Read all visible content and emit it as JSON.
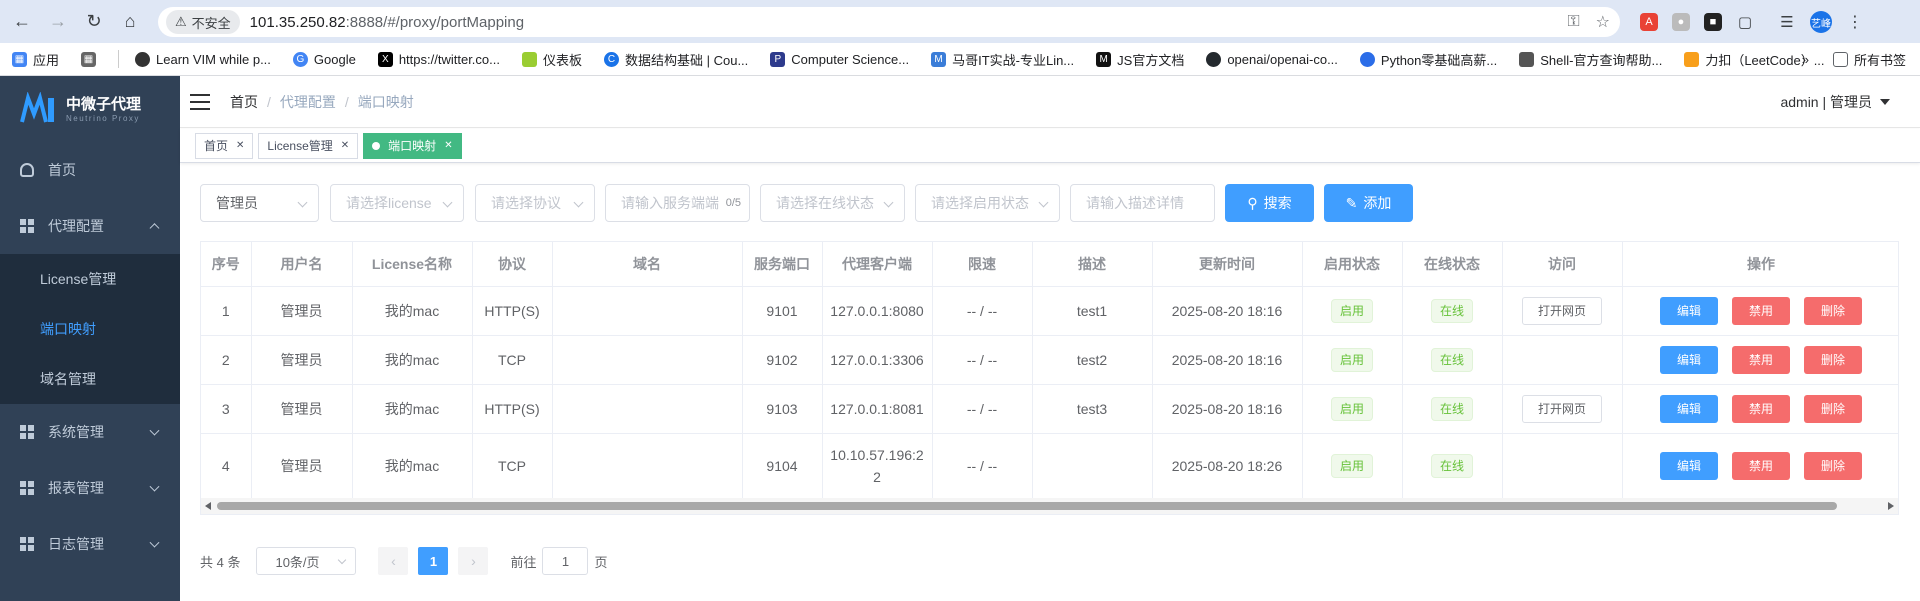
{
  "browser": {
    "insecure_label": "不安全",
    "url_host": "101.35.250.82",
    "url_rest": ":8888/#/proxy/portMapping",
    "profile_label": "艺峰"
  },
  "bookmarks": {
    "apps": "应用",
    "items": [
      "Learn VIM while p...",
      "Google",
      "https://twitter.co...",
      "仪表板",
      "数据结构基础 | Cou...",
      "Computer Science...",
      "马哥IT实战-专业Lin...",
      "JS官方文档",
      "openai/openai-co...",
      "Python零基础高薪...",
      "Shell-官方查询帮助...",
      "力扣（LeetCode）..."
    ],
    "more": "»",
    "all": "所有书签"
  },
  "sidebar": {
    "logo_title": "中微子代理",
    "logo_sub": "Neutrino Proxy",
    "home": "首页",
    "proxy_config": "代理配置",
    "sub": [
      "License管理",
      "端口映射",
      "域名管理"
    ],
    "system": "系统管理",
    "report": "报表管理",
    "log": "日志管理"
  },
  "header": {
    "crumbs": [
      "首页",
      "代理配置",
      "端口映射"
    ],
    "user": "admin | 管理员"
  },
  "tags": [
    "首页",
    "License管理",
    "端口映射"
  ],
  "filters": {
    "user": "管理员",
    "license": "请选择license",
    "protocol": "请选择协议",
    "port": "请输入服务端端",
    "port_count": "0/5",
    "online": "请选择在线状态",
    "enable": "请选择启用状态",
    "desc": "请输入描述详情",
    "search": "搜索",
    "add": "添加"
  },
  "table": {
    "headers": [
      "序号",
      "用户名",
      "License名称",
      "协议",
      "域名",
      "服务端口",
      "代理客户端",
      "限速",
      "描述",
      "更新时间",
      "启用状态",
      "在线状态",
      "访问",
      "操作"
    ],
    "rows": [
      {
        "no": "1",
        "user": "管理员",
        "license": "我的mac",
        "proto": "HTTP(S)",
        "domain": "",
        "port": "9101",
        "client": "127.0.0.1:8080",
        "limit": "-- / --",
        "desc": "test1",
        "time": "2025-08-20 18:16",
        "enable": "启用",
        "online": "在线",
        "visit": "打开网页"
      },
      {
        "no": "2",
        "user": "管理员",
        "license": "我的mac",
        "proto": "TCP",
        "domain": "",
        "port": "9102",
        "client": "127.0.0.1:3306",
        "limit": "-- / --",
        "desc": "test2",
        "time": "2025-08-20 18:16",
        "enable": "启用",
        "online": "在线",
        "visit": ""
      },
      {
        "no": "3",
        "user": "管理员",
        "license": "我的mac",
        "proto": "HTTP(S)",
        "domain": "",
        "port": "9103",
        "client": "127.0.0.1:8081",
        "limit": "-- / --",
        "desc": "test3",
        "time": "2025-08-20 18:16",
        "enable": "启用",
        "online": "在线",
        "visit": "打开网页"
      },
      {
        "no": "4",
        "user": "管理员",
        "license": "我的mac",
        "proto": "TCP",
        "domain": "",
        "port": "9104",
        "client": "10.10.57.196:22",
        "limit": "-- / --",
        "desc": "",
        "time": "2025-08-20 18:26",
        "enable": "启用",
        "online": "在线",
        "visit": ""
      }
    ],
    "ops": {
      "edit": "编辑",
      "disable": "禁用",
      "delete": "删除"
    }
  },
  "pager": {
    "total": "共 4 条",
    "size": "10条/页",
    "current": "1",
    "goto": "前往",
    "goto_value": "1",
    "page_unit": "页"
  }
}
